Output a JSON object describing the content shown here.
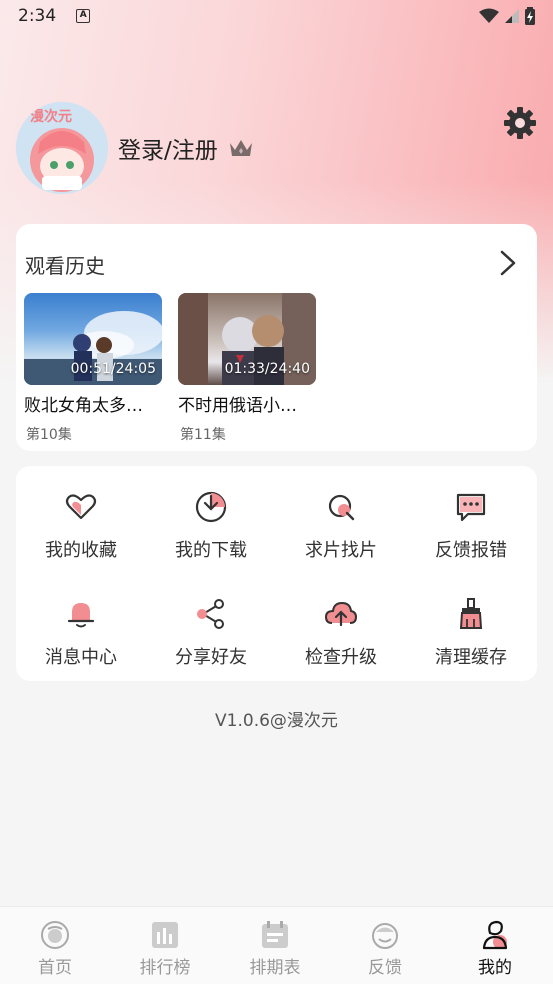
{
  "status_bar": {
    "time": "2:34",
    "notif_letter": "A"
  },
  "profile": {
    "login_label": "登录/注册",
    "avatar_text": "漫次元"
  },
  "history": {
    "title": "观看历史",
    "items": [
      {
        "name": "败北女角太多…",
        "time": "00:51/24:05",
        "episode": "第10集"
      },
      {
        "name": "不时用俄语小…",
        "time": "01:33/24:40",
        "episode": "第11集"
      }
    ]
  },
  "menu": {
    "items": [
      {
        "label": "我的收藏",
        "icon": "heart-icon"
      },
      {
        "label": "我的下载",
        "icon": "download-icon"
      },
      {
        "label": "求片找片",
        "icon": "search-icon"
      },
      {
        "label": "反馈报错",
        "icon": "message-icon"
      },
      {
        "label": "消息中心",
        "icon": "bell-icon"
      },
      {
        "label": "分享好友",
        "icon": "share-icon"
      },
      {
        "label": "检查升级",
        "icon": "cloud-upload-icon"
      },
      {
        "label": "清理缓存",
        "icon": "brush-icon"
      }
    ]
  },
  "version": "V1.0.6@漫次元",
  "tabbar": {
    "tabs": [
      {
        "label": "首页",
        "icon": "home-icon"
      },
      {
        "label": "排行榜",
        "icon": "chart-icon"
      },
      {
        "label": "排期表",
        "icon": "calendar-icon"
      },
      {
        "label": "反馈",
        "icon": "feedback-icon"
      },
      {
        "label": "我的",
        "icon": "profile-icon"
      }
    ],
    "active_index": 4
  },
  "colors": {
    "accent": "#f28d91",
    "active_tab": "#111111",
    "inactive_tab": "#999999"
  }
}
